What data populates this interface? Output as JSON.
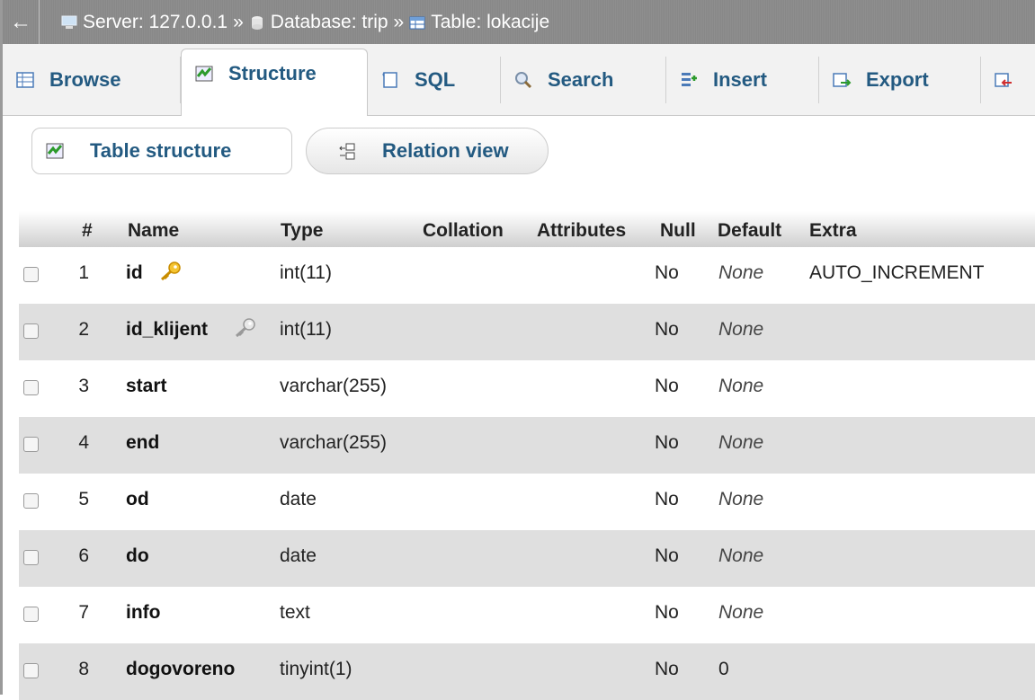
{
  "breadcrumb": {
    "back": "←",
    "server": "Server: 127.0.0.1",
    "sep1": "»",
    "database": "Database: trip",
    "sep2": "»",
    "table": "Table: lokacije"
  },
  "tabs": [
    {
      "label": "Browse",
      "icon": "browse-icon"
    },
    {
      "label": "Structure",
      "icon": "structure-icon"
    },
    {
      "label": "SQL",
      "icon": "sql-icon"
    },
    {
      "label": "Search",
      "icon": "search-icon"
    },
    {
      "label": "Insert",
      "icon": "insert-icon"
    },
    {
      "label": "Export",
      "icon": "export-icon"
    }
  ],
  "subtabs": {
    "table_structure": "Table structure",
    "relation_view": "Relation view"
  },
  "table": {
    "headers": {
      "num": "#",
      "name": "Name",
      "type": "Type",
      "collation": "Collation",
      "attributes": "Attributes",
      "null": "Null",
      "default": "Default",
      "extra": "Extra"
    },
    "rows": [
      {
        "num": "1",
        "name": "id",
        "type": "int(11)",
        "null": "No",
        "default": "None",
        "extra": "AUTO_INCREMENT",
        "key": "primary"
      },
      {
        "num": "2",
        "name": "id_klijent",
        "type": "int(11)",
        "null": "No",
        "default": "None",
        "extra": "",
        "key": "index"
      },
      {
        "num": "3",
        "name": "start",
        "type": "varchar(255)",
        "null": "No",
        "default": "None",
        "extra": ""
      },
      {
        "num": "4",
        "name": "end",
        "type": "varchar(255)",
        "null": "No",
        "default": "None",
        "extra": ""
      },
      {
        "num": "5",
        "name": "od",
        "type": "date",
        "null": "No",
        "default": "None",
        "extra": ""
      },
      {
        "num": "6",
        "name": "do",
        "type": "date",
        "null": "No",
        "default": "None",
        "extra": ""
      },
      {
        "num": "7",
        "name": "info",
        "type": "text",
        "null": "No",
        "default": "None",
        "extra": ""
      },
      {
        "num": "8",
        "name": "dogovoreno",
        "type": "tinyint(1)",
        "null": "No",
        "default": "0",
        "extra": ""
      }
    ]
  },
  "colors": {
    "link": "#235a81",
    "primary_key": "#f0b400",
    "row_alt": "#dfdfdf"
  }
}
